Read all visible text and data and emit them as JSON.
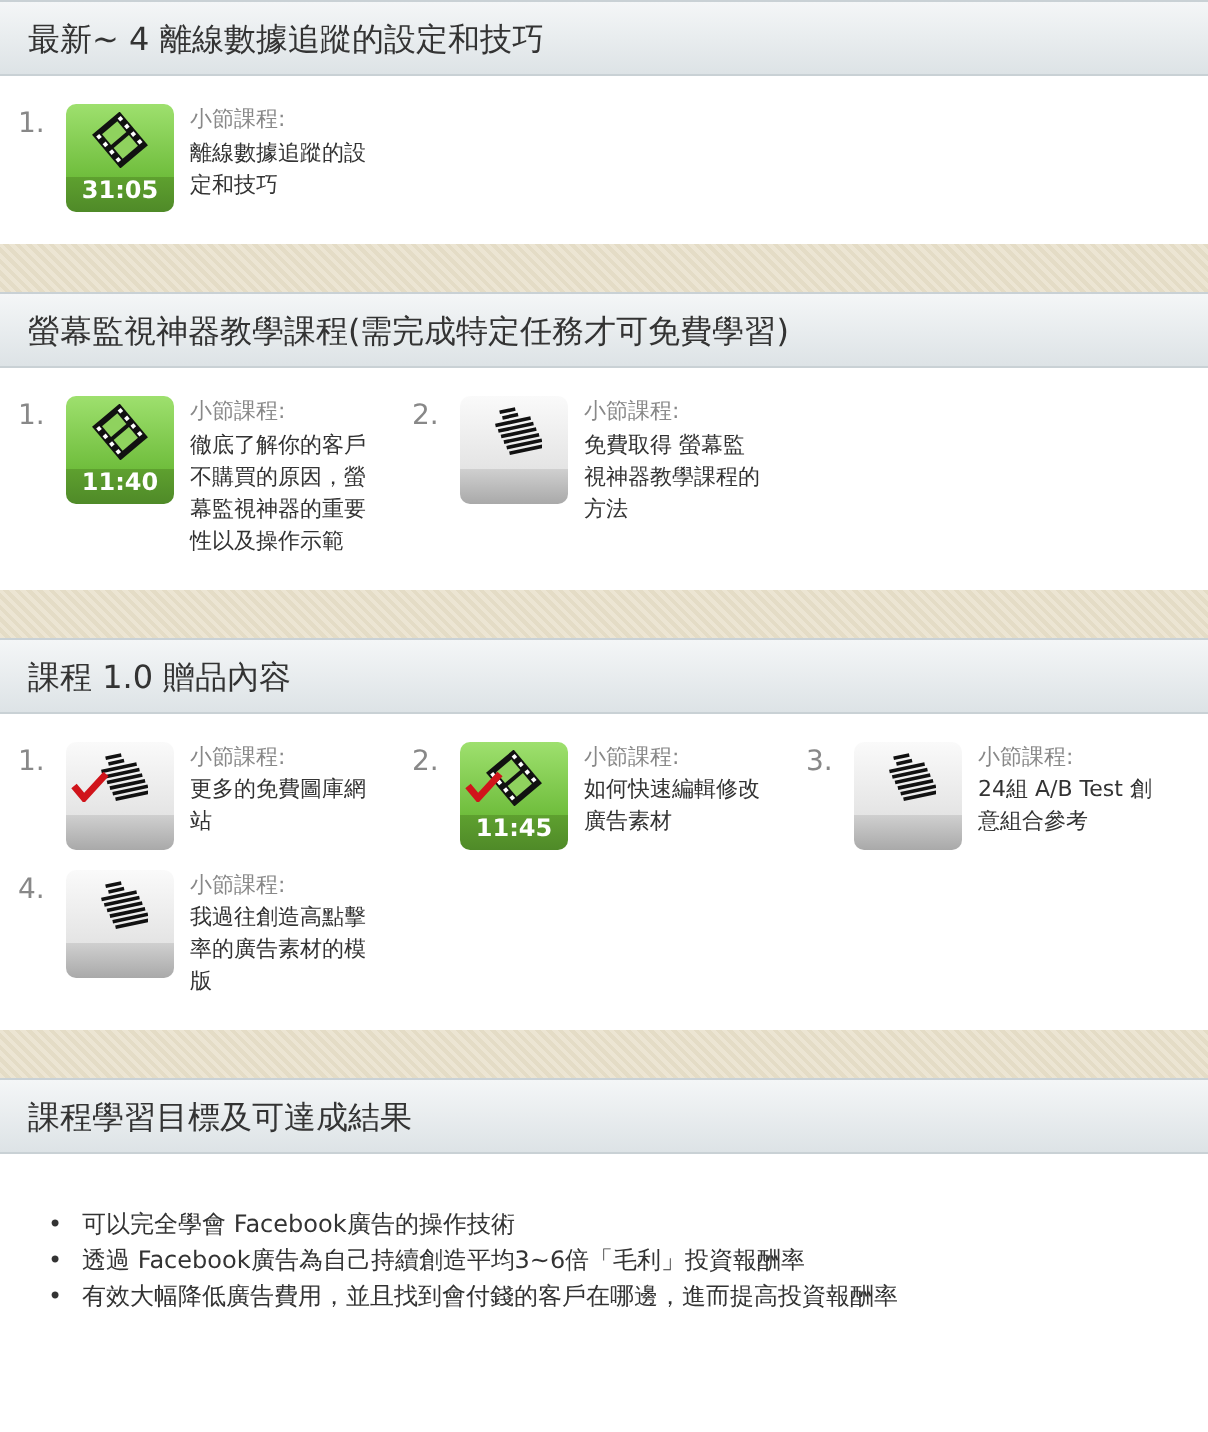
{
  "sections": [
    {
      "title": "最新~ 4 離線數據追蹤的設定和技巧",
      "lessons": [
        {
          "number": "1.",
          "kind": "video",
          "duration": "31:05",
          "completed": false,
          "label": "小節課程:",
          "title": "離線數據追蹤的設定和技巧"
        }
      ]
    },
    {
      "title": "螢幕監視神器教學課程(需完成特定任務才可免費學習)",
      "lessons": [
        {
          "number": "1.",
          "kind": "video",
          "duration": "11:40",
          "completed": false,
          "label": "小節課程:",
          "title": "徹底了解你的客戶不購買的原因，螢幕監視神器的重要性以及操作示範"
        },
        {
          "number": "2.",
          "kind": "document",
          "completed": false,
          "label": "小節課程:",
          "title": "免費取得 螢幕監視神器教學課程的方法"
        }
      ]
    },
    {
      "title": "課程 1.0 贈品內容",
      "lessons": [
        {
          "number": "1.",
          "kind": "document",
          "completed": true,
          "label": "小節課程:",
          "title": "更多的免費圖庫網站"
        },
        {
          "number": "2.",
          "kind": "video",
          "duration": "11:45",
          "completed": true,
          "label": "小節課程:",
          "title": "如何快速編輯修改廣告素材"
        },
        {
          "number": "3.",
          "kind": "document",
          "completed": false,
          "label": "小節課程:",
          "title": "24組 A/B Test 創意組合參考"
        },
        {
          "number": "4.",
          "kind": "document",
          "completed": false,
          "label": "小節課程:",
          "title": "我過往創造高點擊率的廣告素材的模版"
        }
      ]
    },
    {
      "title": "課程學習目標及可達成結果",
      "bullets": [
        {
          "marker": "•",
          "text": "可以完全學會 Facebook廣告的操作技術"
        },
        {
          "marker": "•",
          "text": "透過 Facebook廣告為自己持續創造平均3~6倍「毛利」投資報酬率"
        },
        {
          "marker": "•",
          "text": "有效大幅降低廣告費用，並且找到會付錢的客戶在哪邊，進而提高投資報酬率"
        }
      ]
    }
  ]
}
